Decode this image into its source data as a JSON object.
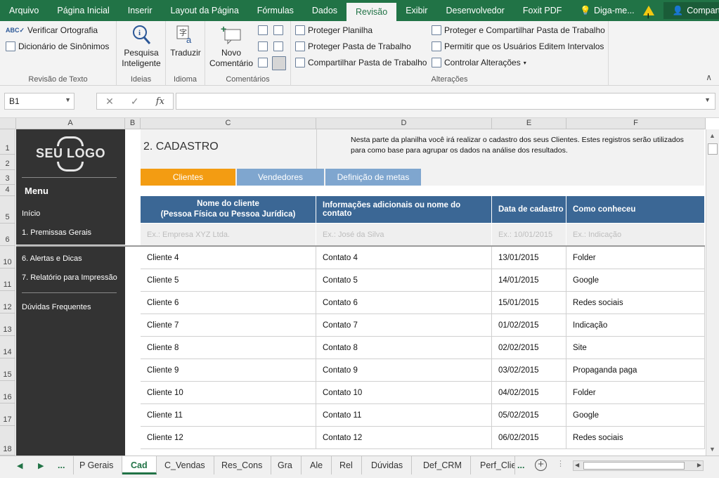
{
  "ribbon_tabs": [
    "Arquivo",
    "Página Inicial",
    "Inserir",
    "Layout da Página",
    "Fórmulas",
    "Dados",
    "Revisão",
    "Exibir",
    "Desenvolvedor",
    "Foxit PDF"
  ],
  "tell_me": "Diga-me...",
  "share": "Compartilhar",
  "ribbon": {
    "revisao_texto": {
      "label": "Revisão de Texto",
      "spell": "Verificar Ortografia",
      "thesaurus": "Dicionário de Sinônimos"
    },
    "ideias": {
      "label": "Ideias",
      "smart_lookup_line1": "Pesquisa",
      "smart_lookup_line2": "Inteligente"
    },
    "idioma": {
      "label": "Idioma",
      "translate": "Traduzir"
    },
    "comentarios": {
      "label": "Comentários",
      "new_line1": "Novo",
      "new_line2": "Comentário"
    },
    "alteracoes": {
      "label": "Alterações",
      "protect_sheet": "Proteger Planilha",
      "protect_workbook": "Proteger Pasta de Trabalho",
      "share_workbook": "Compartilhar Pasta de Trabalho",
      "protect_share": "Proteger e Compartilhar Pasta de Trabalho",
      "allow_edit": "Permitir que os Usuários Editem Intervalos",
      "track_changes": "Controlar Alterações"
    }
  },
  "namebox": "B1",
  "columns": [
    "A",
    "B",
    "C",
    "D",
    "E",
    "F"
  ],
  "rows": [
    "1",
    "2",
    "3",
    "4",
    "5",
    "6",
    "10",
    "11",
    "12",
    "13",
    "14",
    "15",
    "16",
    "17",
    "18"
  ],
  "sidebar": {
    "logo": "SEU LOGO",
    "menu": "Menu",
    "items": [
      "Início",
      "1. Premissas Gerais",
      "6. Alertas e Dicas",
      "7. Relatório para Impressão",
      "Dúvidas Frequentes"
    ]
  },
  "content": {
    "title": "2. CADASTRO",
    "description": "Nesta parte da planilha você irá realizar o cadastro dos seus Clientes. Estes registros serão utilizados para como base para agrupar os dados na análise dos resultados.",
    "tabs": [
      "Clientes",
      "Vendedores",
      "Definição de metas"
    ]
  },
  "table": {
    "headers": {
      "name_line1": "Nome do cliente",
      "name_line2": "(Pessoa Física ou Pessoa Jurídica)",
      "contact": "Informações adicionais ou nome do contato",
      "date": "Data de cadastro",
      "source": "Como conheceu"
    },
    "example": [
      "Ex.: Empresa XYZ Ltda.",
      "Ex.: José da Silva",
      "Ex.: 10/01/2015",
      "Ex.: Indicação"
    ],
    "rows": [
      [
        "Cliente 4",
        "Contato 4",
        "13/01/2015",
        "Folder"
      ],
      [
        "Cliente 5",
        "Contato 5",
        "14/01/2015",
        "Google"
      ],
      [
        "Cliente 6",
        "Contato 6",
        "15/01/2015",
        "Redes sociais"
      ],
      [
        "Cliente 7",
        "Contato 7",
        "01/02/2015",
        "Indicação"
      ],
      [
        "Cliente 8",
        "Contato 8",
        "02/02/2015",
        "Site"
      ],
      [
        "Cliente 9",
        "Contato 9",
        "03/02/2015",
        "Propaganda paga"
      ],
      [
        "Cliente 10",
        "Contato 10",
        "04/02/2015",
        "Folder"
      ],
      [
        "Cliente 11",
        "Contato 11",
        "05/02/2015",
        "Google"
      ],
      [
        "Cliente 12",
        "Contato 12",
        "06/02/2015",
        "Redes sociais"
      ]
    ]
  },
  "sheet_tabs": [
    "...",
    "P Gerais",
    "Cad",
    "C_Vendas",
    "Res_Cons",
    "Gra",
    "Ale",
    "Rel",
    "Dúvidas",
    "Def_CRM",
    "Perf_Clie",
    "..."
  ],
  "colors": {
    "excel_green": "#217346",
    "header_blue": "#3b6795",
    "tab_orange": "#f39c12",
    "tab_blue": "#7fa6cf",
    "sidebar": "#333333"
  }
}
